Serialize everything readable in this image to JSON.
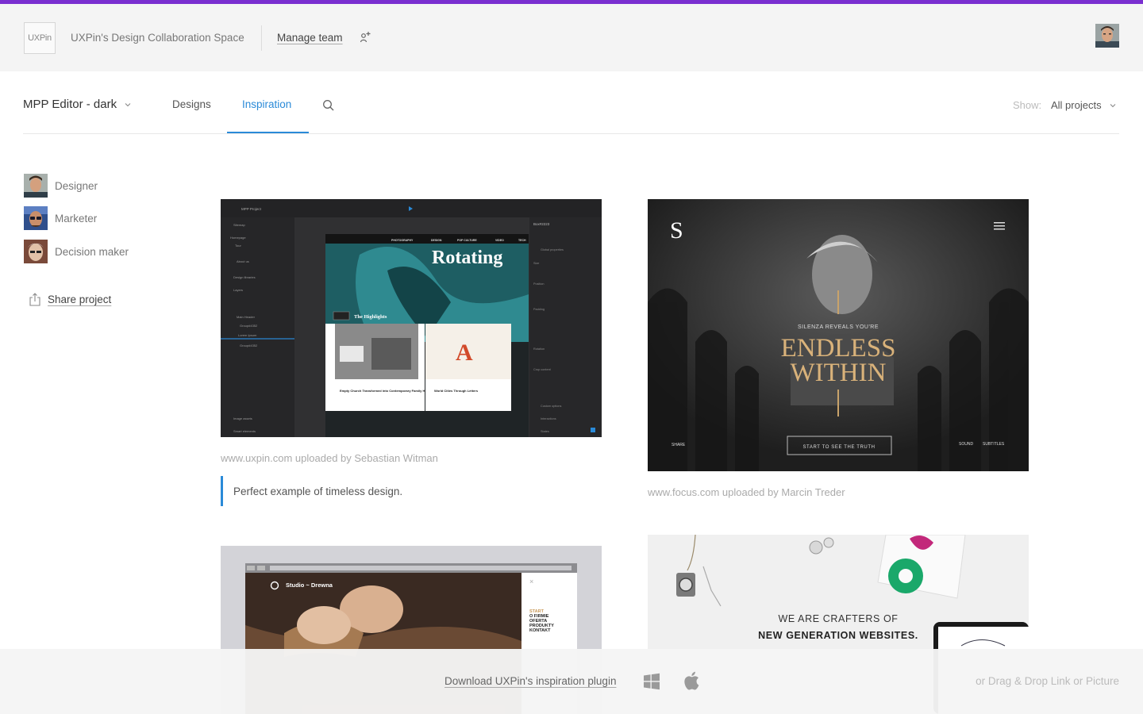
{
  "header": {
    "logo_text": "UXPin",
    "space_title": "UXPin's Design Collaboration Space",
    "manage_team_label": "Manage team",
    "accent_color": "#7a2fd0",
    "add_user_icon": "add-user-icon"
  },
  "nav": {
    "project_name": "MPP Editor - dark",
    "tabs": [
      {
        "label": "Designs",
        "active": false
      },
      {
        "label": "Inspiration",
        "active": true
      }
    ],
    "search_icon": "search-icon",
    "show_label": "Show:",
    "show_value": "All projects",
    "accent_color": "#2a8ad8"
  },
  "sidebar": {
    "roles": [
      {
        "label": "Designer"
      },
      {
        "label": "Marketer"
      },
      {
        "label": "Decision maker"
      }
    ],
    "share_label": "Share project"
  },
  "inspirations": [
    {
      "caption": "www.uxpin.com uploaded by Sebastian Witman",
      "comment": "Perfect example of timeless design.",
      "preview": {
        "app_title": "MPP Project",
        "sidebar_items": [
          "Sitemap",
          "Homepage",
          "Tour",
          "About us",
          "Design libraries",
          "Layers",
          "Main Header",
          "Group#4352",
          "Lorem Ipsum",
          "Group#4352",
          "Image assets",
          "Smart elements"
        ],
        "panel_title": "Box#2223",
        "panel_sections": [
          "Global properties",
          "Size",
          "Position",
          "Padding",
          "Rotation",
          "Crop content",
          "Custom options",
          "Interactions",
          "States"
        ],
        "site_nav": [
          "PHOTOGRAPHY",
          "DESIGN",
          "POP CULTURE",
          "VIDEO",
          "TECH"
        ],
        "hero_word": "Rotating",
        "highlights_label": "The Highlights",
        "article_1": "Empty Church Transformed into Contemporary Family Home",
        "article_2": "World Cities Through Letters",
        "letter": "A"
      }
    },
    {
      "caption": "www.focus.com uploaded by Marcin Treder",
      "preview": {
        "logo": "S",
        "tagline": "SILENZA REVEALS YOU'RE",
        "headline_1": "ENDLESS",
        "headline_2": "WITHIN",
        "cta": "START TO SEE THE TRUTH",
        "left_link": "SHARE",
        "right_link_1": "SOUND",
        "right_link_2": "SUBTITLES"
      }
    },
    {
      "preview": {
        "brand": "Studio ~ Drewna",
        "menu": [
          "START",
          "O FIRMIE",
          "OFERTA",
          "PRODUKTY",
          "KONTAKT"
        ]
      }
    },
    {
      "preview": {
        "line_1": "WE ARE CRAFTERS OF",
        "line_2": "NEW GENERATION WEBSITES."
      }
    }
  ],
  "footer": {
    "download_label": "Download UXPin's inspiration plugin",
    "windows_icon": "windows-icon",
    "apple_icon": "apple-icon",
    "drag_drop_label": "or Drag & Drop Link or Picture"
  }
}
